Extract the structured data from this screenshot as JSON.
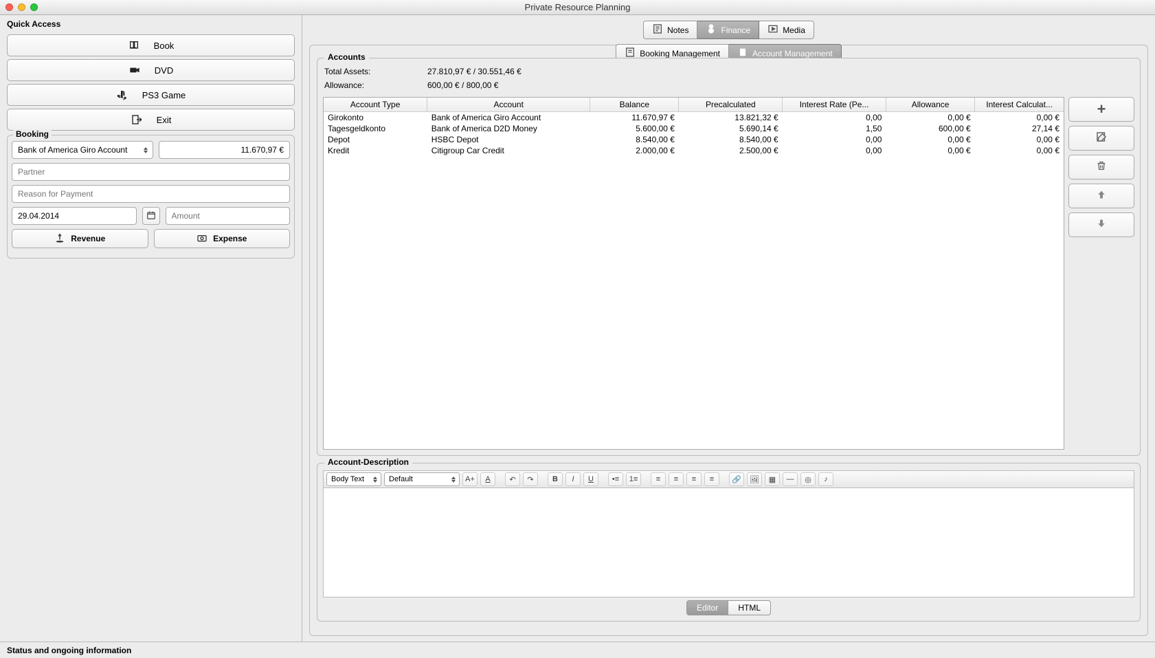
{
  "window": {
    "title": "Private Resource Planning",
    "status": "Status and ongoing information"
  },
  "quickaccess": {
    "title": "Quick Access",
    "book": "Book",
    "dvd": "DVD",
    "ps3": "PS3 Game",
    "exit": "Exit"
  },
  "booking": {
    "title": "Booking",
    "account_selected": "Bank of America Giro Account",
    "balance_display": "11.670,97 €",
    "partner_placeholder": "Partner",
    "reason_placeholder": "Reason for Payment",
    "date_value": "29.04.2014",
    "amount_placeholder": "Amount",
    "revenue_label": "Revenue",
    "expense_label": "Expense"
  },
  "topTabs": {
    "notes": "Notes",
    "finance": "Finance",
    "media": "Media"
  },
  "subTabs": {
    "booking_mgmt": "Booking Management",
    "account_mgmt": "Account Management"
  },
  "accounts": {
    "legend": "Accounts",
    "total_assets_label": "Total Assets:",
    "total_assets_value": "27.810,97 €  /  30.551,46 €",
    "allowance_label": "Allowance:",
    "allowance_value": "600,00 €  /  800,00 €",
    "columns": [
      "Account Type",
      "Account",
      "Balance",
      "Precalculated",
      "Interest Rate (Pe...",
      "Allowance",
      "Interest Calculat..."
    ],
    "rows": [
      {
        "type": "Girokonto",
        "account": "Bank of America Giro Account",
        "balance": "11.670,97 €",
        "precalc": "13.821,32 €",
        "rate": "0,00",
        "allowance": "0,00 €",
        "interest": "0,00 €"
      },
      {
        "type": "Tagesgeldkonto",
        "account": "Bank of America D2D Money",
        "balance": "5.600,00 €",
        "precalc": "5.690,14 €",
        "rate": "1,50",
        "allowance": "600,00 €",
        "interest": "27,14 €"
      },
      {
        "type": "Depot",
        "account": "HSBC Depot",
        "balance": "8.540,00 €",
        "precalc": "8.540,00 €",
        "rate": "0,00",
        "allowance": "0,00 €",
        "interest": "0,00 €"
      },
      {
        "type": "Kredit",
        "account": "Citigroup Car Credit",
        "balance": "2.000,00 €",
        "precalc": "2.500,00 €",
        "rate": "0,00",
        "allowance": "0,00 €",
        "interest": "0,00 €"
      }
    ]
  },
  "description": {
    "legend": "Account-Description",
    "style_select": "Body Text",
    "font_select": "Default",
    "mode_editor": "Editor",
    "mode_html": "HTML"
  }
}
